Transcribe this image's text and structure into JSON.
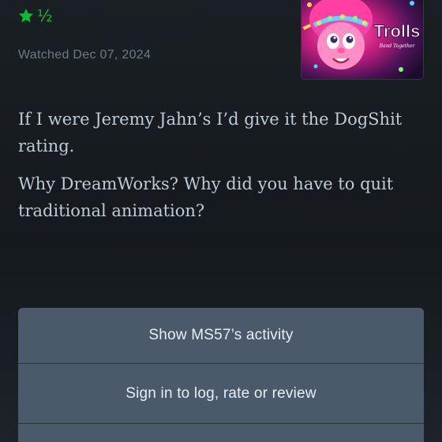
{
  "rating": {
    "stars": 1.5,
    "half_glyph": "½",
    "star_icon": "star-icon",
    "color": "#00c030"
  },
  "watched": {
    "text": "Watched Dec 07, 2024"
  },
  "poster": {
    "title": "Trolls",
    "subtitle": "Band Together"
  },
  "review": {
    "paragraphs": [
      "If I were Jeremy Jahn’s I’d give it the DogShit rating.",
      "Why DreamWorks? Why did you have to quit traditional animation?"
    ]
  },
  "actions": {
    "items": [
      {
        "label": "Show MS57’s activity"
      },
      {
        "label": "Sign in to log, rate or review"
      },
      {
        "label": ""
      }
    ]
  },
  "colors": {
    "background": "#15191d",
    "accent_green": "#00c030",
    "body_text": "#bccbd6",
    "muted_text": "#6c7a87",
    "button_bg": "#4a5a6a"
  }
}
